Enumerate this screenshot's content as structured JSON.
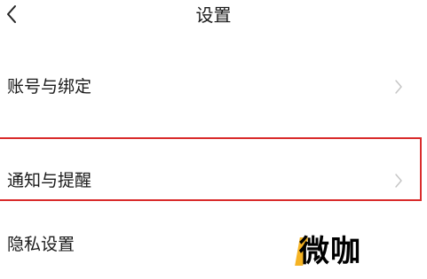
{
  "header": {
    "title": "设置",
    "back_icon": "chevron-left-icon"
  },
  "settings": {
    "items": [
      {
        "label": "账号与绑定",
        "icon": "chevron-right-icon"
      },
      {
        "label": "通知与提醒",
        "icon": "chevron-right-icon",
        "highlighted": true
      },
      {
        "label": "隐私设置"
      }
    ]
  },
  "annotation": {
    "highlight_color": "#d92b2b"
  },
  "watermark": {
    "text": "微咖",
    "accent_color": "#f5b324"
  }
}
